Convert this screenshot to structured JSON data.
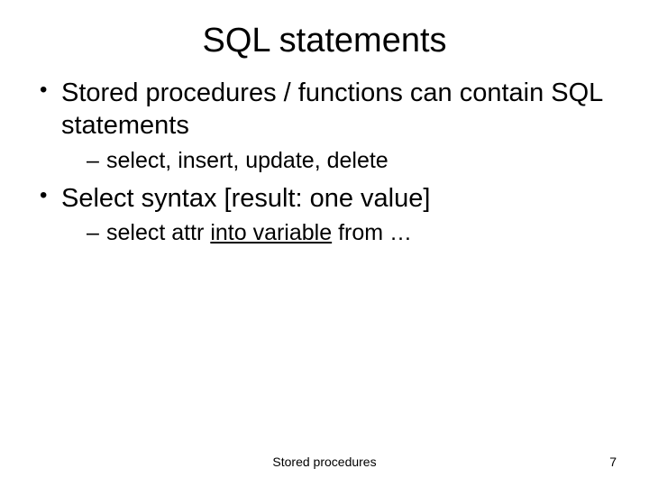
{
  "title": "SQL statements",
  "bullets": {
    "b1": "Stored procedures / functions can contain SQL statements",
    "b1_sub1": "select, insert, update, delete",
    "b2": "Select syntax [result: one value]",
    "b2_sub1_pre": "select attr ",
    "b2_sub1_u": "into variable",
    "b2_sub1_post": " from …"
  },
  "footer": {
    "center": "Stored procedures",
    "page": "7"
  }
}
